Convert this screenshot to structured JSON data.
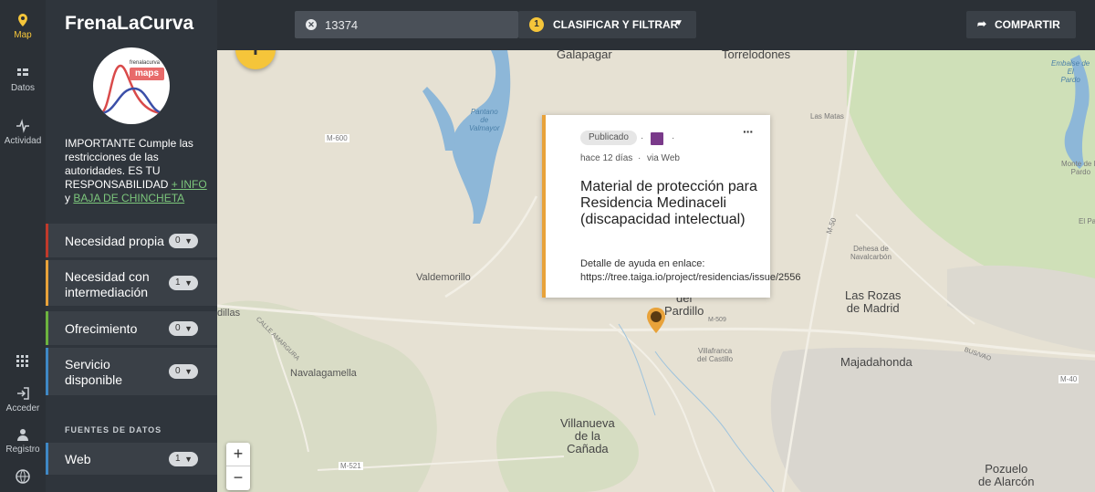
{
  "rail": {
    "map_label": "Map",
    "data_label": "Datos",
    "activity_label": "Actividad",
    "login_label": "Acceder",
    "register_label": "Registro"
  },
  "sidebar": {
    "brand": "FrenaLaCurva",
    "logo_small": "frenalacurva",
    "logo_badge": "maps",
    "notice_text": "IMPORTANTE Cumple las restricciones de las autoridades. ES TU RESPONSABILIDAD",
    "notice_link_info": "+ INFO",
    "notice_and": "y",
    "notice_link_unpin": "BAJA DE CHINCHETA",
    "categories": [
      {
        "label": "Necesidad propia",
        "count": "0",
        "color": "#c0392b"
      },
      {
        "label": "Necesidad con intermediación",
        "count": "1",
        "color": "#e8a23a"
      },
      {
        "label": "Ofrecimiento",
        "count": "0",
        "color": "#6db33f"
      },
      {
        "label": "Servicio disponible",
        "count": "0",
        "color": "#3f88c5"
      }
    ],
    "sources_title": "FUENTES DE DATOS",
    "sources": [
      {
        "label": "Web",
        "count": "1",
        "color": "#3f88c5"
      }
    ]
  },
  "topbar": {
    "search_value": "13374",
    "filter_count": "1",
    "filter_label": "CLASIFICAR Y FILTRAR",
    "share_label": "COMPARTIR"
  },
  "map": {
    "add_label": "+",
    "zoom_in": "+",
    "zoom_out": "−",
    "places": {
      "galapagar": "Galapagar",
      "torrelodones": "Torrelodones",
      "valdemorillo": "Valdemorillo",
      "navalagamella": "Navalagamella",
      "villanueva_line1": "Villanueva",
      "villanueva_line2": "de la",
      "villanueva_line3": "Cañada",
      "pardillo_line1": "del",
      "pardillo_line2": "Pardillo",
      "las_rozas_line1": "Las Rozas",
      "las_rozas_line2": "de Madrid",
      "majadahonda": "Majadahonda",
      "pozuelo_line1": "Pozuelo",
      "pozuelo_line2": "de Alarcón",
      "las_matas": "Las Matas",
      "villafranca_line1": "Villafranca",
      "villafranca_line2": "del Castillo",
      "dehesa_line1": "Dehesa de",
      "dehesa_line2": "Navalcarbón",
      "montecl_line1": "Monte de El",
      "montecl_line2": "Pardo",
      "el_pa": "El Pa",
      "embalse_line1": "Embalse de",
      "embalse_line2": "El",
      "embalse_line3": "Pardo",
      "pantano_line1": "Pantano",
      "pantano_line2": "de",
      "pantano_line3": "Valmayor",
      "m600": "M-600",
      "m521": "M-521",
      "m50": "M-50",
      "m40": "M-40",
      "dillas": "dillas",
      "calle_amargura": "CALLE AMARGURA",
      "bus_vao": "BUS/VAO",
      "m509": "M-509"
    }
  },
  "popup": {
    "status": "Publicado",
    "separator": "·",
    "menu": "···",
    "time": "hace 12 días",
    "via": "via Web",
    "title": "Material de protección para Residencia Medinaceli (discapacidad intelectual)",
    "desc_line1": "Detalle de ayuda en enlace:",
    "desc_line2": "https://tree.taiga.io/project/residencias/issue/2556"
  }
}
